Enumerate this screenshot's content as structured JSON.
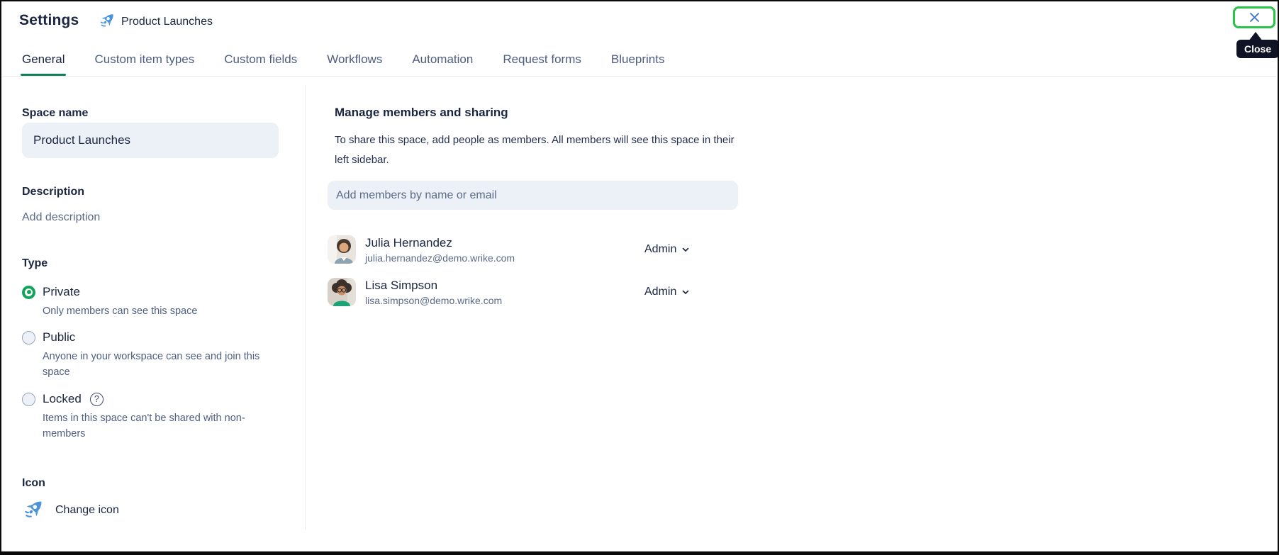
{
  "window": {
    "title": "Settings"
  },
  "header": {
    "space_name": "Product Launches"
  },
  "close_button": {
    "tooltip": "Close"
  },
  "tabs": [
    {
      "label": "General",
      "active": true
    },
    {
      "label": "Custom item types",
      "active": false
    },
    {
      "label": "Custom fields",
      "active": false
    },
    {
      "label": "Workflows",
      "active": false
    },
    {
      "label": "Automation",
      "active": false
    },
    {
      "label": "Request forms",
      "active": false
    },
    {
      "label": "Blueprints",
      "active": false
    }
  ],
  "general": {
    "space_name": {
      "label": "Space name",
      "value": "Product Launches"
    },
    "description": {
      "label": "Description",
      "placeholder": "Add description"
    },
    "type": {
      "label": "Type",
      "options": [
        {
          "label": "Private",
          "description": "Only members can see this space",
          "selected": true,
          "help": false
        },
        {
          "label": "Public",
          "description": "Anyone in your workspace can see and join this space",
          "selected": false,
          "help": false
        },
        {
          "label": "Locked",
          "description": "Items in this space can't be shared with non-members",
          "selected": false,
          "help": true
        }
      ]
    },
    "icon": {
      "label": "Icon",
      "action": "Change icon"
    }
  },
  "members": {
    "heading": "Manage members and sharing",
    "intro": "To share this space, add people as members. All members will see this space in their left sidebar.",
    "add_input_placeholder": "Add members by name or email",
    "list": [
      {
        "name": "Julia Hernandez",
        "email": "julia.hernandez@demo.wrike.com",
        "role": "Admin"
      },
      {
        "name": "Lisa Simpson",
        "email": "lisa.simpson@demo.wrike.com",
        "role": "Admin"
      }
    ]
  },
  "colors": {
    "accent_green_underline": "#12805a",
    "radio_selected_green": "#12a45c",
    "highlight_border_green": "#28c246",
    "rocket_blue": "#4b94d8",
    "close_x_blue": "#3f6fd8",
    "tooltip_bg": "#0e1425",
    "input_bg": "#ecf0f7",
    "text_primary": "#1b2642",
    "text_muted": "#5b6a87"
  }
}
